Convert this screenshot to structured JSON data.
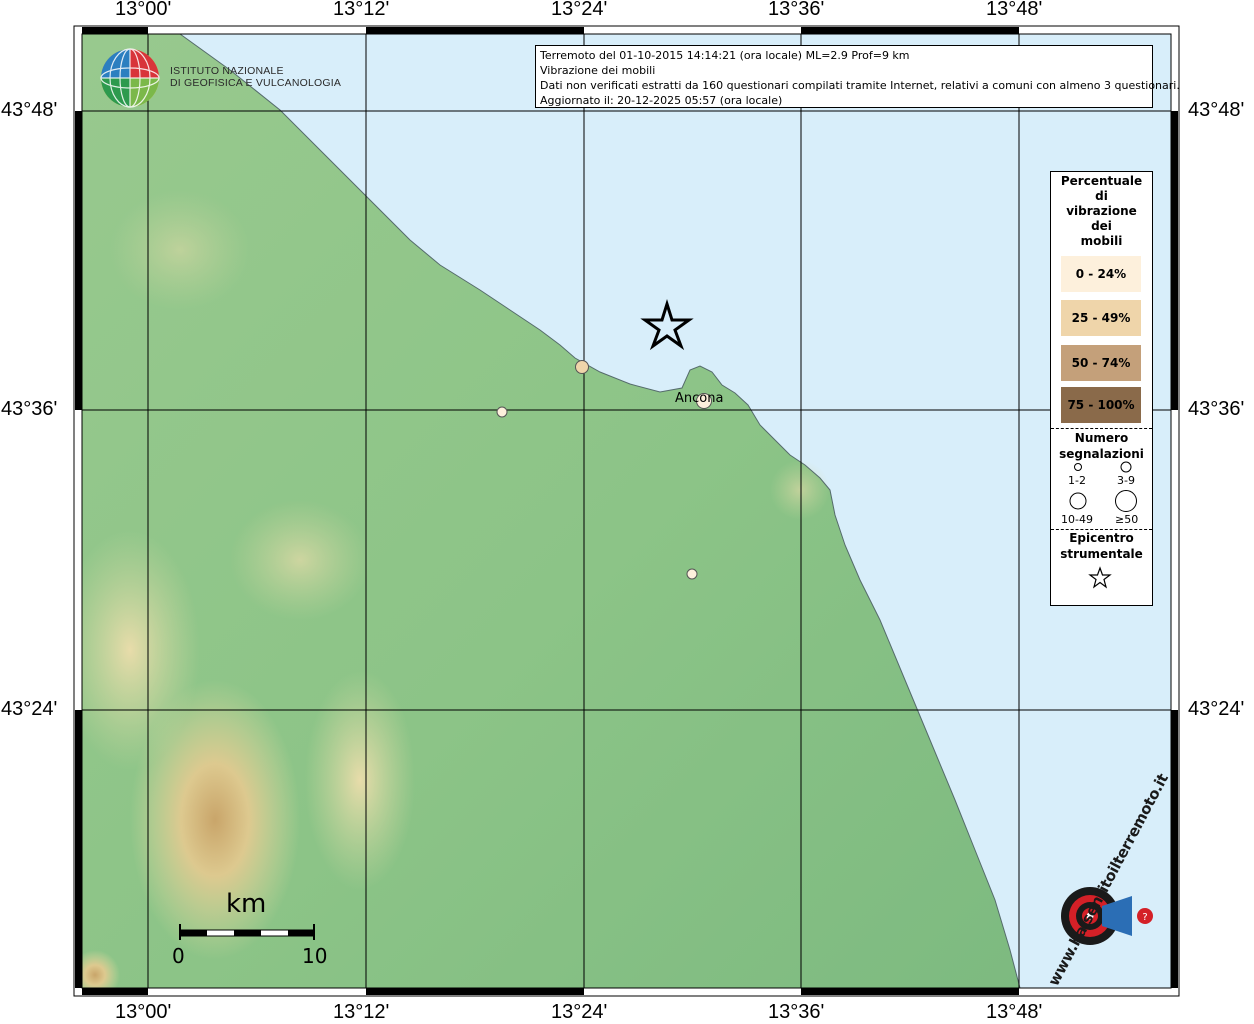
{
  "map": {
    "lon_labels": [
      "13°00'",
      "13°12'",
      "13°24'",
      "13°36'",
      "13°48'"
    ],
    "lat_labels": [
      "43°48'",
      "43°36'",
      "43°24'"
    ]
  },
  "info": {
    "line1": "Terremoto del 01-10-2015 14:14:21 (ora locale) ML=2.9 Prof=9 km",
    "line2": "Vibrazione dei mobili",
    "line3": "Dati non verificati estratti da 160 questionari compilati tramite Internet, relativi a comuni con almeno 3 questionari.",
    "line4": "Aggiornato il: 20-12-2025 05:57 (ora locale)"
  },
  "logo_ingv": {
    "line1": "ISTITUTO NAZIONALE",
    "line2": "DI GEOFISICA E VULCANOLOGIA"
  },
  "legend": {
    "title_lines": [
      "Percentuale",
      "di",
      "vibrazione",
      "dei",
      "mobili"
    ],
    "classes": [
      {
        "label": "0 - 24%",
        "color": "#fdf0dc"
      },
      {
        "label": "25 - 49%",
        "color": "#efd5aa"
      },
      {
        "label": "50 - 74%",
        "color": "#c4a07a"
      },
      {
        "label": "75 - 100%",
        "color": "#8a6a4a"
      }
    ],
    "count_title_lines": [
      "Numero",
      "segnalazioni"
    ],
    "count_classes": [
      "1-2",
      "3-9",
      "10-49",
      "≥50"
    ],
    "epicenter_title_lines": [
      "Epicentro",
      "strumentale"
    ]
  },
  "places": [
    {
      "name": "Ancona"
    }
  ],
  "scale": {
    "title": "km",
    "min": "0",
    "max": "10"
  },
  "logo_hst": {
    "text": "www.haisentitoilterremoto.it"
  },
  "colors": {
    "sea": "#d8eefa",
    "land_low": "#8cc78a",
    "land_mid": "#a9cf92",
    "land_high": "#e6d6a0",
    "peak": "#c39a60"
  }
}
